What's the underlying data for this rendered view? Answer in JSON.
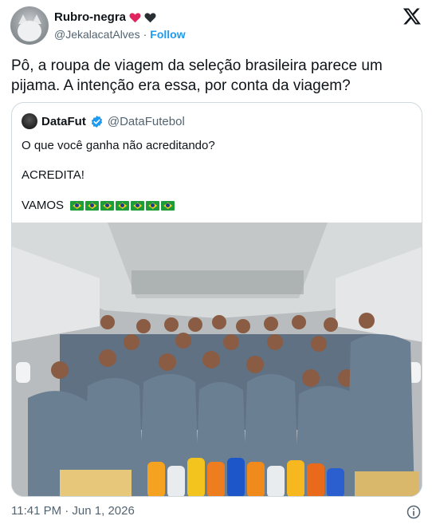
{
  "author": {
    "display_name": "Rubro-negra",
    "handle": "@JekalacatAlves",
    "separator": "·",
    "follow_label": "Follow",
    "avatar_icon": "cat-avatar",
    "heart_colors": [
      "#e0245e",
      "#0f1419"
    ]
  },
  "tweet": {
    "text": "Pô, a roupa de viagem da seleção brasileira parece um pijama. A intenção era essa, por conta da viagem?"
  },
  "quoted": {
    "display_name": "DataFut",
    "handle": "@DataFutebol",
    "verified_icon": "verified-badge-icon",
    "lines": [
      "O que você ganha não acreditando?",
      "ACREDITA!",
      "VAMOS"
    ],
    "flag_count": 7,
    "flag_icon": "brazil-flag-icon",
    "image_description_icon": "team-photo"
  },
  "footer": {
    "timestamp": "11:41 PM · Jun 1, 2026"
  },
  "colors": {
    "accent": "#1d9bf0",
    "secondary_text": "#536471",
    "border": "#cfd9de"
  }
}
